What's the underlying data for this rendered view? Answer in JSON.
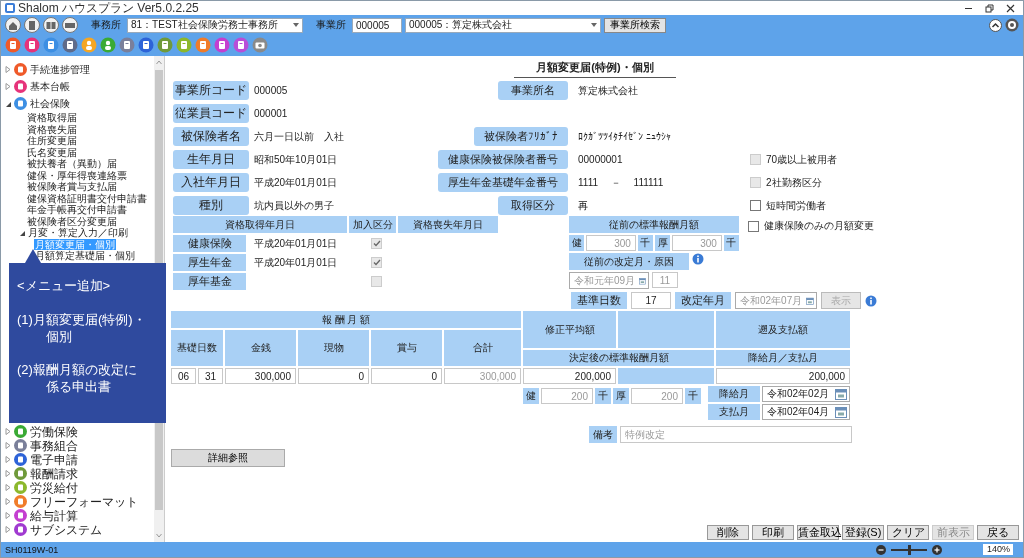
{
  "window": {
    "title": "Shalom ハウスプラン Ver5.0.2.25"
  },
  "toolbar": {
    "office_label": "事務所",
    "office": "81：TEST社会保険労務士事務所",
    "company_label": "事業所",
    "company_code": "000005",
    "company": "000005：算定株式会社",
    "search_button": "事業所検索"
  },
  "sidebar": {
    "items": [
      {
        "label": "手続進捗管理",
        "color": "#ef5a2a",
        "expanded": false
      },
      {
        "label": "基本台帳",
        "color": "#e6337a",
        "expanded": false
      },
      {
        "label": "社会保険",
        "color": "#3d8fe3",
        "expanded": true,
        "children": [
          {
            "label": "資格取得届",
            "selected": false
          },
          {
            "label": "資格喪失届",
            "selected": false
          },
          {
            "label": "住所変更届",
            "selected": false
          },
          {
            "label": "氏名変更届",
            "selected": false
          },
          {
            "label": "被扶養者（異動）届",
            "selected": false
          },
          {
            "label": "健保・厚年得喪連絡票",
            "selected": false
          },
          {
            "label": "被保険者賞与支払届",
            "selected": false
          },
          {
            "label": "健保資格証明書交付申請書",
            "selected": false
          },
          {
            "label": "年金手帳再交付申請書",
            "selected": false
          },
          {
            "label": "被保険者区分変更届",
            "selected": false
          },
          {
            "label": "月変・算定入力／印刷",
            "expanded": true,
            "children": [
              {
                "label": "月額変更届・個別",
                "selected": true
              },
              {
                "label": "月額算定基礎届・個別",
                "selected": false
              }
            ]
          }
        ]
      }
    ],
    "lower_items": [
      {
        "label": "労働保険",
        "color": "#3aaa35",
        "expanded": false
      },
      {
        "label": "事務組合",
        "color": "#7a7f9a",
        "expanded": false
      },
      {
        "label": "電子申請",
        "color": "#2d63d8",
        "expanded": false
      },
      {
        "label": "報酬請求",
        "color": "#6f9a3a",
        "expanded": false
      },
      {
        "label": "労災給付",
        "color": "#8cb82c",
        "expanded": false
      },
      {
        "label": "フリーフォーマット",
        "color": "#f07c2a",
        "expanded": false
      },
      {
        "label": "給与計算",
        "color": "#c43fd0",
        "expanded": false
      },
      {
        "label": "サブシステム",
        "color": "#a03ad0",
        "expanded": false
      }
    ]
  },
  "callout": {
    "title": "<メニュー追加>",
    "items": [
      "(1)月額変更届(特例)・個別",
      "(2)報酬月額の改定に係る申出書"
    ]
  },
  "form": {
    "title": "月額変更届(特例)・個別",
    "rows": [
      {
        "label": "事業所コード",
        "value": "000005",
        "right_label": "事業所名",
        "right_value": "算定株式会社"
      },
      {
        "label": "従業員コード",
        "value": "000001"
      },
      {
        "label": "被保険者名",
        "value": "六月一日以前　入社",
        "right_label": "被保険者ﾌﾘｶﾞﾅ",
        "right_value": "ﾛｸｶﾞﾂﾂｲﾀﾁｲｾﾞﾝ ﾆｭｳｼｬ"
      },
      {
        "label": "生年月日",
        "value": "昭和50年10月01日",
        "right_label": "健康保険被保険者番号",
        "right_value": "00000001",
        "option": {
          "label": "70歳以上被用者",
          "checked": false,
          "disabled": true
        }
      },
      {
        "label": "入社年月日",
        "value": "平成20年01月01日",
        "right_label": "厚生年金基礎年金番号",
        "right_value": "1111　 －　 111111",
        "option": {
          "label": "2社勤務区分",
          "checked": false,
          "disabled": true
        }
      },
      {
        "label": "種別",
        "value": "坑内員以外の男子",
        "right_label": "取得区分",
        "right_value": "再",
        "option": {
          "label": "短時間労働者",
          "checked": false,
          "disabled": false
        }
      }
    ],
    "qualification": {
      "headers": [
        "資格取得年月日",
        "加入区分",
        "資格喪失年月日"
      ],
      "rows": [
        {
          "label": "健康保険",
          "date": "平成20年01月01日",
          "enrolled": true
        },
        {
          "label": "厚生年金",
          "date": "平成20年01月01日",
          "enrolled": true
        },
        {
          "label": "厚年基金",
          "enrolled": false
        }
      ]
    },
    "previous": {
      "header": "従前の標準報酬月額",
      "amounts": [
        {
          "label": "健",
          "value": "300",
          "unit": "千"
        },
        {
          "label": "厚",
          "value": "300",
          "unit": "千"
        }
      ],
      "revision_header": "従前の改定月・原因",
      "revision_month": "令和元年09月",
      "revision_cause": "11"
    },
    "health_only_option": {
      "label": "健康保険のみの月額変更",
      "checked": false,
      "disabled": false
    },
    "base": {
      "days_label": "基準日数",
      "days": "17",
      "month_label": "改定年月",
      "month": "令和02年07月",
      "month_disabled": true,
      "button": "表示",
      "button_disabled": true
    },
    "pay": {
      "header": "報 酬 月 額",
      "columns": [
        "基礎日数",
        "金銭",
        "現物",
        "賞与",
        "合計"
      ],
      "values": [
        "06",
        "31",
        "300,000",
        "0",
        "0",
        "300,000"
      ]
    },
    "decision": {
      "average_header": "修正平均額",
      "retro_header": "遡及支払額",
      "decided_header": "決定後の標準報酬月額",
      "month_header": "降給月／支払月",
      "average": "200,000",
      "retro": "200,000",
      "amounts": [
        {
          "label": "健",
          "value": "200",
          "unit": "千"
        },
        {
          "label": "厚",
          "value": "200",
          "unit": "千"
        }
      ],
      "months": [
        {
          "label": "降給月",
          "value": "令和02年02月"
        },
        {
          "label": "支払月",
          "value": "令和02年04月"
        }
      ]
    },
    "remarks": {
      "label": "備考",
      "value": "特例改定"
    },
    "detail_button": "詳細参照"
  },
  "buttons": [
    {
      "label": "削除",
      "disabled": false
    },
    {
      "label": "印刷",
      "disabled": false
    },
    {
      "label": "賃金取込",
      "disabled": false
    },
    {
      "label": "登録(S)",
      "disabled": false
    },
    {
      "label": "クリア",
      "disabled": false
    },
    {
      "label": "前表示",
      "disabled": true
    },
    {
      "label": "戻る",
      "disabled": false
    }
  ],
  "status_bar": {
    "screen_id": "SH0119W-01",
    "zoom": {
      "level": 0.5,
      "reading": "140%"
    }
  }
}
